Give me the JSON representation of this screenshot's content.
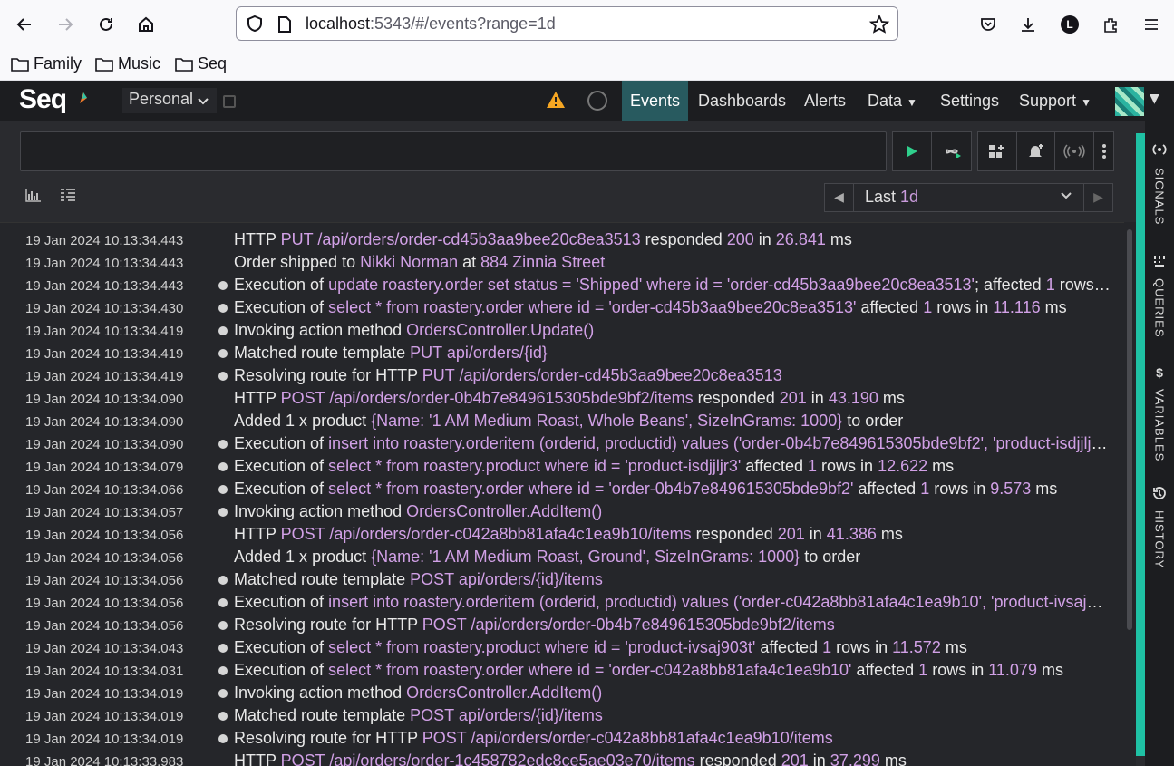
{
  "browser": {
    "url_host": "localhost",
    "url_rest": ":5343/#/events?range=1d",
    "profile_initial": "L",
    "bookmarks": [
      "Family",
      "Music",
      "Seq"
    ]
  },
  "seq": {
    "logo": "Seq",
    "workspace": "Personal",
    "nav": [
      "Events",
      "Dashboards",
      "Alerts",
      "Data",
      "Settings",
      "Support"
    ],
    "query_placeholder": ""
  },
  "range": {
    "prefix": "Last ",
    "value": "1d"
  },
  "sidebar": [
    "SIGNALS",
    "QUERIES",
    "VARIABLES",
    "HISTORY"
  ],
  "events": [
    {
      "time": "19 Jan 2024  10:13:34.443",
      "dot": false,
      "parts": [
        [
          "HTTP ",
          0
        ],
        [
          "PUT",
          1
        ],
        [
          " ",
          0
        ],
        [
          "/api/orders/order-cd45b3aa9bee20c8ea3513",
          1
        ],
        [
          " responded ",
          0
        ],
        [
          "200",
          1
        ],
        [
          " in ",
          0
        ],
        [
          "26.841",
          1
        ],
        [
          " ms",
          0
        ]
      ]
    },
    {
      "time": "19 Jan 2024  10:13:34.443",
      "dot": false,
      "parts": [
        [
          "Order shipped to ",
          0
        ],
        [
          "Nikki Norman",
          1
        ],
        [
          " at ",
          0
        ],
        [
          "884 Zinnia Street",
          1
        ]
      ]
    },
    {
      "time": "19 Jan 2024  10:13:34.443",
      "dot": true,
      "parts": [
        [
          "Execution of ",
          0
        ],
        [
          "update roastery.order set status = 'Shipped' where id = 'order-cd45b3aa9bee20c8ea3513'",
          1
        ],
        [
          "; affected ",
          0
        ],
        [
          "1",
          1
        ],
        [
          " rows in ",
          0
        ],
        [
          "1...",
          1
        ]
      ]
    },
    {
      "time": "19 Jan 2024  10:13:34.430",
      "dot": true,
      "parts": [
        [
          "Execution of ",
          0
        ],
        [
          "select * from roastery.order where id = 'order-cd45b3aa9bee20c8ea3513'",
          1
        ],
        [
          " affected ",
          0
        ],
        [
          "1",
          1
        ],
        [
          " rows in ",
          0
        ],
        [
          "11.116",
          1
        ],
        [
          " ms",
          0
        ]
      ]
    },
    {
      "time": "19 Jan 2024  10:13:34.419",
      "dot": true,
      "parts": [
        [
          "Invoking action method ",
          0
        ],
        [
          "OrdersController.Update()",
          1
        ]
      ]
    },
    {
      "time": "19 Jan 2024  10:13:34.419",
      "dot": true,
      "parts": [
        [
          "Matched route template ",
          0
        ],
        [
          "PUT",
          1
        ],
        [
          " ",
          0
        ],
        [
          "api/orders/{id}",
          1
        ]
      ]
    },
    {
      "time": "19 Jan 2024  10:13:34.419",
      "dot": true,
      "parts": [
        [
          "Resolving route for HTTP ",
          0
        ],
        [
          "PUT",
          1
        ],
        [
          " ",
          0
        ],
        [
          "/api/orders/order-cd45b3aa9bee20c8ea3513",
          1
        ]
      ]
    },
    {
      "time": "19 Jan 2024  10:13:34.090",
      "dot": false,
      "parts": [
        [
          "HTTP ",
          0
        ],
        [
          "POST",
          1
        ],
        [
          " ",
          0
        ],
        [
          "/api/orders/order-0b4b7e849615305bde9bf2/items",
          1
        ],
        [
          " responded ",
          0
        ],
        [
          "201",
          1
        ],
        [
          " in ",
          0
        ],
        [
          "43.190",
          1
        ],
        [
          " ms",
          0
        ]
      ]
    },
    {
      "time": "19 Jan 2024  10:13:34.090",
      "dot": false,
      "parts": [
        [
          "Added 1 x product ",
          0
        ],
        [
          "{Name: '1 AM Medium Roast, Whole Beans', SizeInGrams: 1000}",
          1
        ],
        [
          " to order",
          0
        ]
      ]
    },
    {
      "time": "19 Jan 2024  10:13:34.090",
      "dot": true,
      "parts": [
        [
          "Execution of ",
          0
        ],
        [
          "insert into roastery.orderitem (orderid, productid) values ('order-0b4b7e849615305bde9bf2', 'product-isdjjljr3')",
          1
        ],
        [
          " ...",
          0
        ]
      ]
    },
    {
      "time": "19 Jan 2024  10:13:34.079",
      "dot": true,
      "parts": [
        [
          "Execution of ",
          0
        ],
        [
          "select * from roastery.product where id = 'product-isdjjljr3'",
          1
        ],
        [
          " affected ",
          0
        ],
        [
          "1",
          1
        ],
        [
          " rows in ",
          0
        ],
        [
          "12.622",
          1
        ],
        [
          " ms",
          0
        ]
      ]
    },
    {
      "time": "19 Jan 2024  10:13:34.066",
      "dot": true,
      "parts": [
        [
          "Execution of ",
          0
        ],
        [
          "select * from roastery.order where id = 'order-0b4b7e849615305bde9bf2'",
          1
        ],
        [
          " affected ",
          0
        ],
        [
          "1",
          1
        ],
        [
          " rows in ",
          0
        ],
        [
          "9.573",
          1
        ],
        [
          " ms",
          0
        ]
      ]
    },
    {
      "time": "19 Jan 2024  10:13:34.057",
      "dot": true,
      "parts": [
        [
          "Invoking action method ",
          0
        ],
        [
          "OrdersController.AddItem()",
          1
        ]
      ]
    },
    {
      "time": "19 Jan 2024  10:13:34.056",
      "dot": false,
      "parts": [
        [
          "HTTP ",
          0
        ],
        [
          "POST",
          1
        ],
        [
          " ",
          0
        ],
        [
          "/api/orders/order-c042a8bb81afa4c1ea9b10/items",
          1
        ],
        [
          " responded ",
          0
        ],
        [
          "201",
          1
        ],
        [
          " in ",
          0
        ],
        [
          "41.386",
          1
        ],
        [
          " ms",
          0
        ]
      ]
    },
    {
      "time": "19 Jan 2024  10:13:34.056",
      "dot": false,
      "parts": [
        [
          "Added 1 x product ",
          0
        ],
        [
          "{Name: '1 AM Medium Roast, Ground', SizeInGrams: 1000}",
          1
        ],
        [
          " to order",
          0
        ]
      ]
    },
    {
      "time": "19 Jan 2024  10:13:34.056",
      "dot": true,
      "parts": [
        [
          "Matched route template ",
          0
        ],
        [
          "POST",
          1
        ],
        [
          " ",
          0
        ],
        [
          "api/orders/{id}/items",
          1
        ]
      ]
    },
    {
      "time": "19 Jan 2024  10:13:34.056",
      "dot": true,
      "parts": [
        [
          "Execution of ",
          0
        ],
        [
          "insert into roastery.orderitem (orderid, productid) values ('order-c042a8bb81afa4c1ea9b10', 'product-ivsaj903t'...",
          1
        ]
      ]
    },
    {
      "time": "19 Jan 2024  10:13:34.056",
      "dot": true,
      "parts": [
        [
          "Resolving route for HTTP ",
          0
        ],
        [
          "POST",
          1
        ],
        [
          " ",
          0
        ],
        [
          "/api/orders/order-0b4b7e849615305bde9bf2/items",
          1
        ]
      ]
    },
    {
      "time": "19 Jan 2024  10:13:34.043",
      "dot": true,
      "parts": [
        [
          "Execution of ",
          0
        ],
        [
          "select * from roastery.product where id = 'product-ivsaj903t'",
          1
        ],
        [
          " affected ",
          0
        ],
        [
          "1",
          1
        ],
        [
          " rows in ",
          0
        ],
        [
          "11.572",
          1
        ],
        [
          " ms",
          0
        ]
      ]
    },
    {
      "time": "19 Jan 2024  10:13:34.031",
      "dot": true,
      "parts": [
        [
          "Execution of ",
          0
        ],
        [
          "select * from roastery.order where id = 'order-c042a8bb81afa4c1ea9b10'",
          1
        ],
        [
          " affected ",
          0
        ],
        [
          "1",
          1
        ],
        [
          " rows in ",
          0
        ],
        [
          "11.079",
          1
        ],
        [
          " ms",
          0
        ]
      ]
    },
    {
      "time": "19 Jan 2024  10:13:34.019",
      "dot": true,
      "parts": [
        [
          "Invoking action method ",
          0
        ],
        [
          "OrdersController.AddItem()",
          1
        ]
      ]
    },
    {
      "time": "19 Jan 2024  10:13:34.019",
      "dot": true,
      "parts": [
        [
          "Matched route template ",
          0
        ],
        [
          "POST",
          1
        ],
        [
          " ",
          0
        ],
        [
          "api/orders/{id}/items",
          1
        ]
      ]
    },
    {
      "time": "19 Jan 2024  10:13:34.019",
      "dot": true,
      "parts": [
        [
          "Resolving route for HTTP ",
          0
        ],
        [
          "POST",
          1
        ],
        [
          " ",
          0
        ],
        [
          "/api/orders/order-c042a8bb81afa4c1ea9b10/items",
          1
        ]
      ]
    },
    {
      "time": "19 Jan 2024  10:13:33.983",
      "dot": false,
      "parts": [
        [
          "HTTP ",
          0
        ],
        [
          "POST",
          1
        ],
        [
          " ",
          0
        ],
        [
          "/api/orders/order-1c458782edc8ce5ae03e70/items",
          1
        ],
        [
          " responded ",
          0
        ],
        [
          "201",
          1
        ],
        [
          " in ",
          0
        ],
        [
          "37.299",
          1
        ],
        [
          " ms",
          0
        ]
      ]
    }
  ],
  "colors": {
    "accent": "#1fc1a4",
    "property": "#d1a0e6",
    "nav_active": "#285a5f",
    "warning": "#f5a623"
  }
}
